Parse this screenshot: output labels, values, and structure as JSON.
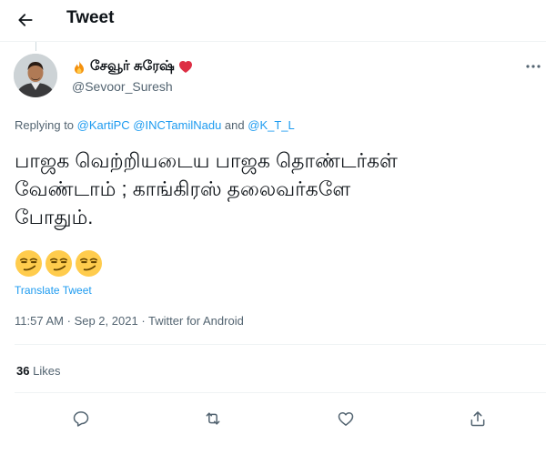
{
  "header": {
    "title": "Tweet",
    "back_icon": "arrow-left-icon"
  },
  "author": {
    "display_name": "சேவூர் சுரேஷ்",
    "prefix_icon": "fire-emoji",
    "suffix_icon": "red-heart-emoji",
    "handle": "@Sevoor_Suresh",
    "avatar": "profile-photo"
  },
  "reply": {
    "prefix": "Replying to",
    "mentions": [
      "@KartiPC",
      "@INCTamilNadu",
      "@K_T_L"
    ],
    "conjunction": "and"
  },
  "tweet": {
    "lines": [
      "பாஜக வெற்றியடைய பாஜக தொண்டர்கள்",
      "வேண்டாம் ; காங்கிரஸ் தலைவர்களே",
      "போதும்."
    ],
    "emoji": [
      "smirking-face",
      "smirking-face",
      "smirking-face"
    ],
    "translate_label": "Translate Tweet"
  },
  "meta": {
    "time": "11:57 AM",
    "separator": "·",
    "date": "Sep 2, 2021",
    "source": "Twitter for Android"
  },
  "stats": {
    "likes_count": "36",
    "likes_label": "Likes"
  },
  "actions": [
    "reply-icon",
    "retweet-icon",
    "like-icon",
    "share-icon"
  ],
  "colors": {
    "link": "#1d9bf0",
    "secondary_text": "#536471",
    "primary_text": "#0f1419",
    "divider": "#eff3f4"
  }
}
